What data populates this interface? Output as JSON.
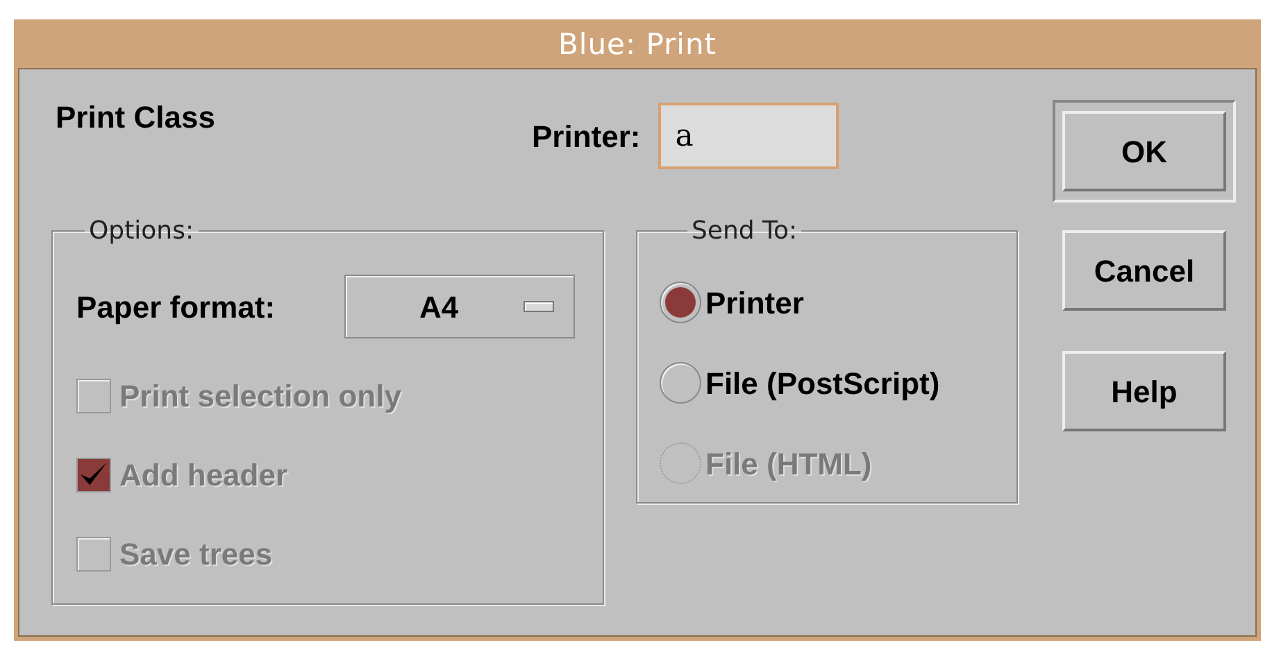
{
  "window": {
    "title": "Blue: Print"
  },
  "heading": "Print Class",
  "printer_field": {
    "label": "Printer:",
    "value": "a"
  },
  "options": {
    "legend": "Options:",
    "paper_format": {
      "label": "Paper format:",
      "value": "A4"
    },
    "checkboxes": [
      {
        "label": "Print selection only",
        "checked": false,
        "disabled": true
      },
      {
        "label": "Add header",
        "checked": true,
        "disabled": true
      },
      {
        "label": "Save trees",
        "checked": false,
        "disabled": true
      }
    ]
  },
  "send_to": {
    "legend": "Send To:",
    "radios": [
      {
        "label": "Printer",
        "selected": true,
        "disabled": false
      },
      {
        "label": "File (PostScript)",
        "selected": false,
        "disabled": false
      },
      {
        "label": "File (HTML)",
        "selected": false,
        "disabled": true
      }
    ]
  },
  "buttons": [
    {
      "label": "OK",
      "default": true
    },
    {
      "label": "Cancel",
      "default": false
    },
    {
      "label": "Help",
      "default": false
    }
  ]
}
